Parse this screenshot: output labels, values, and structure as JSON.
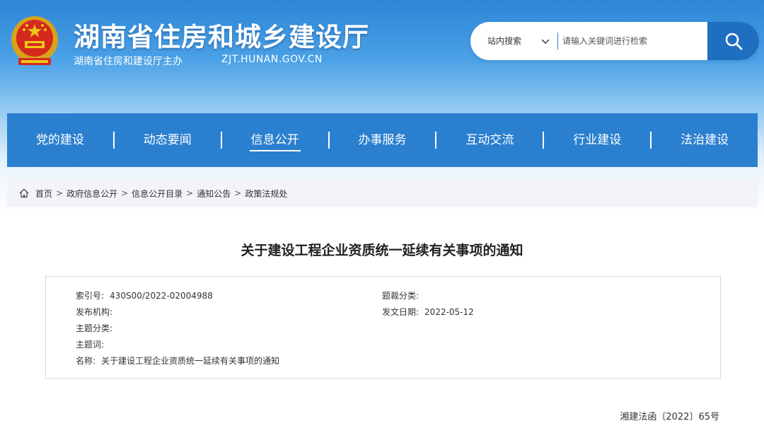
{
  "header": {
    "site_title": "湖南省住房和城乡建设厅",
    "sponsor": "湖南省住房和建设厅主办",
    "domain": "ZJT.HUNAN.GOV.CN",
    "emblem_icon": "national-emblem-icon"
  },
  "search": {
    "scope": "站内搜索",
    "placeholder": "请输入关键词进行检索",
    "button_icon": "search-icon"
  },
  "nav": {
    "items": [
      {
        "label": "党的建设"
      },
      {
        "label": "动态要闻"
      },
      {
        "label": "信息公开",
        "active": true
      },
      {
        "label": "办事服务"
      },
      {
        "label": "互动交流"
      },
      {
        "label": "行业建设"
      },
      {
        "label": "法治建设"
      }
    ]
  },
  "breadcrumb": {
    "items": [
      "首页",
      "政府信息公开",
      "信息公开目录",
      "通知公告",
      "政策法规处"
    ],
    "separator": ">"
  },
  "article": {
    "title": "关于建设工程企业资质统一延续有关事项的通知",
    "meta": {
      "index_label": "索引号:",
      "index_value": "430S00/2022-02004988",
      "category_label": "题裁分类:",
      "category_value": "",
      "publisher_label": "发布机构:",
      "publisher_value": "",
      "date_label": "发文日期:",
      "date_value": "2022-05-12",
      "subject_label": "主题分类:",
      "subject_value": "",
      "keywords_label": "主题词:",
      "keywords_value": "",
      "name_label": "名称:",
      "name_value": "关于建设工程企业资质统一延续有关事项的通知"
    },
    "doc_number": "湘建法函〔2022〕65号"
  },
  "colors": {
    "primary": "#2b7fcf",
    "search_button": "#1f6fc0",
    "breadcrumb_bg": "#f2f4f7"
  }
}
